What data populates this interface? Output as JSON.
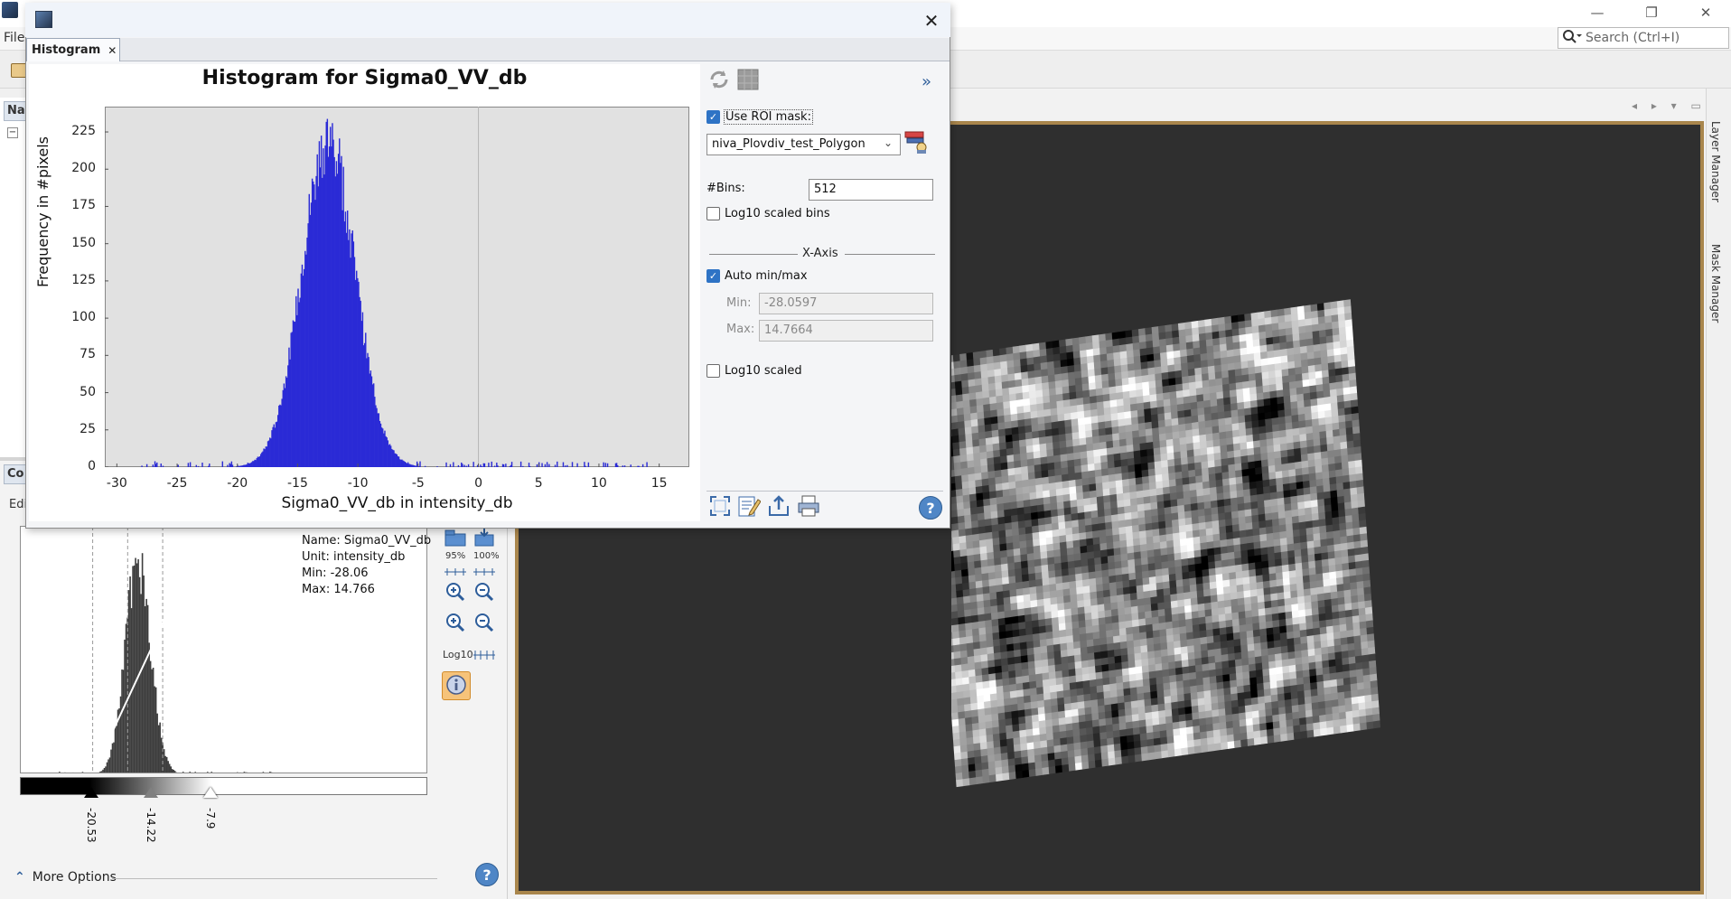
{
  "app": {
    "menu_file": "File",
    "search_placeholder": "Search (Ctrl+I)",
    "window_controls": {
      "minimize": "—",
      "restore": "❐",
      "close": "✕"
    }
  },
  "left_panel": {
    "navigation_tab": "Nav",
    "tree_toggle": "−",
    "colour_tab": "Co",
    "editor_label": "Edi",
    "band_info": {
      "name": "Name: Sigma0_VV_db",
      "unit": "Unit: intensity_db",
      "min": "Min: -28.06",
      "max": "Max: 14.766"
    },
    "sliders": [
      {
        "label": "-20.53",
        "value": -20.53,
        "color": "#000000"
      },
      {
        "label": "-14.22",
        "value": -14.22,
        "color": "#808080"
      },
      {
        "label": "-7.9",
        "value": -7.9,
        "color": "#ffffff"
      }
    ],
    "tools": {
      "zoom_95_caption": "95%",
      "zoom_100_caption": "100%",
      "log_caption": "Log10"
    },
    "more_options": "More Options",
    "help": "?"
  },
  "side_tabs": {
    "layer_manager": "Layer Manager",
    "mask_manager": "Mask Manager"
  },
  "view": {
    "nav_arrows": "◂ ▸ ▾ ▭"
  },
  "dialog": {
    "close": "✕",
    "tab_label": "Histogram",
    "tab_close": "✕",
    "controls": {
      "expand": "»",
      "use_roi_mask": "Use ROI mask:",
      "use_roi_mask_checked": true,
      "roi_mask_value": "niva_Plovdiv_test_Polygon",
      "bins_label": "#Bins:",
      "bins_value": "512",
      "log10_bins": "Log10 scaled bins",
      "log10_bins_checked": false,
      "xaxis_title": "X-Axis",
      "auto_minmax": "Auto min/max",
      "auto_minmax_checked": true,
      "min_label": "Min:",
      "min_value": "-28.0597",
      "max_label": "Max:",
      "max_value": "14.7664",
      "log10_scaled": "Log10 scaled",
      "log10_scaled_checked": false,
      "help": "?"
    }
  },
  "chart_data": {
    "type": "bar",
    "title": "Histogram for Sigma0_VV_db",
    "xlabel": "Sigma0_VV_db in intensity_db",
    "ylabel": "Frequency in #pixels",
    "xlim": [
      -31,
      17.5
    ],
    "ylim": [
      0,
      242
    ],
    "xticks": [
      -30,
      -25,
      -20,
      -15,
      -10,
      -5,
      0,
      5,
      10,
      15
    ],
    "yticks": [
      0,
      25,
      50,
      75,
      100,
      125,
      150,
      175,
      200,
      225
    ],
    "grid": true,
    "legend": "none",
    "series_color": "#2a2ad6",
    "bins": 512,
    "range": [
      -28.0597,
      14.7664
    ],
    "peak_center": -12.5,
    "peak_height": 225,
    "spread": 2.2
  }
}
